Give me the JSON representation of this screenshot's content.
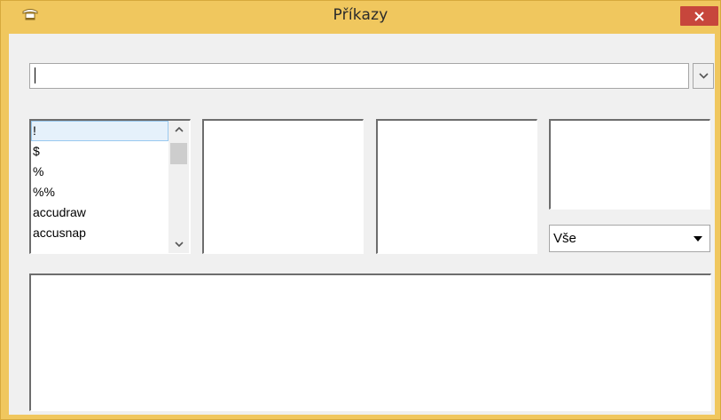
{
  "window": {
    "title": "Příkazy",
    "accent_color": "#f0c75e",
    "close_color": "#c7463c",
    "app_icon": "hat-icon",
    "close_icon": "close-icon"
  },
  "command_combo": {
    "value": "",
    "dropdown_icon": "chevron-down-icon"
  },
  "command_list": {
    "items": [
      "!",
      "$",
      "%",
      "%%",
      "accudraw",
      "accusnap"
    ],
    "selected_index": 0
  },
  "filter_select": {
    "value": "Vše",
    "dropdown_icon": "caret-down-icon"
  }
}
